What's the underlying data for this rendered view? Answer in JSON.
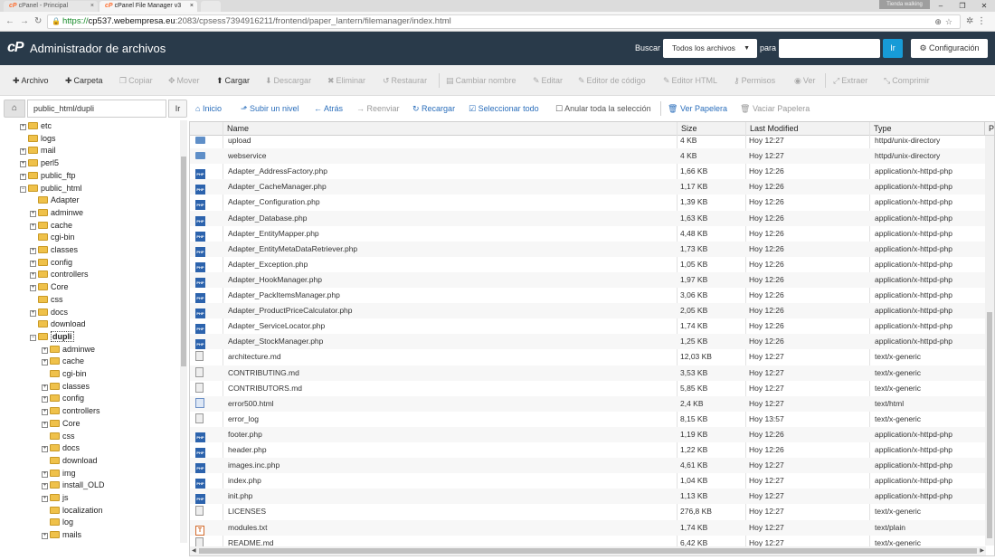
{
  "browser": {
    "tabs": [
      {
        "label": "cPanel - Principal"
      },
      {
        "label": "cPanel File Manager v3"
      }
    ],
    "profile": "Tienda walking",
    "url": {
      "scheme": "https://",
      "host": "cp537.webempresa.eu",
      "path": ":2083/cpsess7394916211/frontend/paper_lantern/filemanager/index.html"
    }
  },
  "header": {
    "logo": "cP",
    "title": "Administrador de archivos",
    "search_label": "Buscar",
    "search_scope": "Todos los archivos",
    "para_label": "para",
    "go_label": "Ir",
    "config_label": "Configuración"
  },
  "toolbar": {
    "archivo": "Archivo",
    "carpeta": "Carpeta",
    "copiar": "Copiar",
    "mover": "Mover",
    "cargar": "Cargar",
    "descargar": "Descargar",
    "eliminar": "Eliminar",
    "restaurar": "Restaurar",
    "cambiar_nombre": "Cambiar nombre",
    "editar": "Editar",
    "editor_codigo": "Editor de código",
    "editor_html": "Editor HTML",
    "permisos": "Permisos",
    "ver": "Ver",
    "extraer": "Extraer",
    "comprimir": "Comprimir"
  },
  "pathbar": {
    "value": "public_html/dupli",
    "go_label": "Ir"
  },
  "actions": {
    "inicio": "Inicio",
    "subir": "Subir un nivel",
    "atras": "Atrás",
    "reenviar": "Reenviar",
    "recargar": "Recargar",
    "seleccionar_todo": "Seleccionar todo",
    "anular": "Anular toda la selección",
    "ver_papelera": "Ver Papelera",
    "vaciar_papelera": "Vaciar Papelera"
  },
  "tree": [
    {
      "label": "etc",
      "level": 0,
      "expandable": true
    },
    {
      "label": "logs",
      "level": 0,
      "expandable": false
    },
    {
      "label": "mail",
      "level": 0,
      "expandable": true
    },
    {
      "label": "perl5",
      "level": 0,
      "expandable": true
    },
    {
      "label": "public_ftp",
      "level": 0,
      "expandable": true
    },
    {
      "label": "public_html",
      "level": 0,
      "expandable": true,
      "open": true
    },
    {
      "label": "Adapter",
      "level": 1,
      "expandable": false
    },
    {
      "label": "adminwe",
      "level": 1,
      "expandable": true
    },
    {
      "label": "cache",
      "level": 1,
      "expandable": true
    },
    {
      "label": "cgi-bin",
      "level": 1,
      "expandable": false
    },
    {
      "label": "classes",
      "level": 1,
      "expandable": true
    },
    {
      "label": "config",
      "level": 1,
      "expandable": true
    },
    {
      "label": "controllers",
      "level": 1,
      "expandable": true
    },
    {
      "label": "Core",
      "level": 1,
      "expandable": true
    },
    {
      "label": "css",
      "level": 1,
      "expandable": false
    },
    {
      "label": "docs",
      "level": 1,
      "expandable": true
    },
    {
      "label": "download",
      "level": 1,
      "expandable": false
    },
    {
      "label": "dupli",
      "level": 1,
      "expandable": true,
      "open": true,
      "selected": true
    },
    {
      "label": "adminwe",
      "level": 2,
      "expandable": true
    },
    {
      "label": "cache",
      "level": 2,
      "expandable": true
    },
    {
      "label": "cgi-bin",
      "level": 2,
      "expandable": false
    },
    {
      "label": "classes",
      "level": 2,
      "expandable": true
    },
    {
      "label": "config",
      "level": 2,
      "expandable": true
    },
    {
      "label": "controllers",
      "level": 2,
      "expandable": true
    },
    {
      "label": "Core",
      "level": 2,
      "expandable": true
    },
    {
      "label": "css",
      "level": 2,
      "expandable": false
    },
    {
      "label": "docs",
      "level": 2,
      "expandable": true
    },
    {
      "label": "download",
      "level": 2,
      "expandable": false
    },
    {
      "label": "img",
      "level": 2,
      "expandable": true
    },
    {
      "label": "install_OLD",
      "level": 2,
      "expandable": true
    },
    {
      "label": "js",
      "level": 2,
      "expandable": true
    },
    {
      "label": "localization",
      "level": 2,
      "expandable": false
    },
    {
      "label": "log",
      "level": 2,
      "expandable": false
    },
    {
      "label": "mails",
      "level": 2,
      "expandable": true
    }
  ],
  "table": {
    "headers": {
      "name": "Name",
      "size": "Size",
      "modified": "Last Modified",
      "type": "Type",
      "extra": "P"
    },
    "rows": [
      {
        "icon": "folder",
        "name": "upload",
        "size": "4 KB",
        "modified": "Hoy 12:27",
        "type": "httpd/unix-directory"
      },
      {
        "icon": "folder",
        "name": "webservice",
        "size": "4 KB",
        "modified": "Hoy 12:27",
        "type": "httpd/unix-directory"
      },
      {
        "icon": "php",
        "name": "Adapter_AddressFactory.php",
        "size": "1,66 KB",
        "modified": "Hoy 12:26",
        "type": "application/x-httpd-php"
      },
      {
        "icon": "php",
        "name": "Adapter_CacheManager.php",
        "size": "1,17 KB",
        "modified": "Hoy 12:26",
        "type": "application/x-httpd-php"
      },
      {
        "icon": "php",
        "name": "Adapter_Configuration.php",
        "size": "1,39 KB",
        "modified": "Hoy 12:26",
        "type": "application/x-httpd-php"
      },
      {
        "icon": "php",
        "name": "Adapter_Database.php",
        "size": "1,63 KB",
        "modified": "Hoy 12:26",
        "type": "application/x-httpd-php"
      },
      {
        "icon": "php",
        "name": "Adapter_EntityMapper.php",
        "size": "4,48 KB",
        "modified": "Hoy 12:26",
        "type": "application/x-httpd-php"
      },
      {
        "icon": "php",
        "name": "Adapter_EntityMetaDataRetriever.php",
        "size": "1,73 KB",
        "modified": "Hoy 12:26",
        "type": "application/x-httpd-php"
      },
      {
        "icon": "php",
        "name": "Adapter_Exception.php",
        "size": "1,05 KB",
        "modified": "Hoy 12:26",
        "type": "application/x-httpd-php"
      },
      {
        "icon": "php",
        "name": "Adapter_HookManager.php",
        "size": "1,97 KB",
        "modified": "Hoy 12:26",
        "type": "application/x-httpd-php"
      },
      {
        "icon": "php",
        "name": "Adapter_PackItemsManager.php",
        "size": "3,06 KB",
        "modified": "Hoy 12:26",
        "type": "application/x-httpd-php"
      },
      {
        "icon": "php",
        "name": "Adapter_ProductPriceCalculator.php",
        "size": "2,05 KB",
        "modified": "Hoy 12:26",
        "type": "application/x-httpd-php"
      },
      {
        "icon": "php",
        "name": "Adapter_ServiceLocator.php",
        "size": "1,74 KB",
        "modified": "Hoy 12:26",
        "type": "application/x-httpd-php"
      },
      {
        "icon": "php",
        "name": "Adapter_StockManager.php",
        "size": "1,25 KB",
        "modified": "Hoy 12:26",
        "type": "application/x-httpd-php"
      },
      {
        "icon": "generic",
        "name": "architecture.md",
        "size": "12,03 KB",
        "modified": "Hoy 12:27",
        "type": "text/x-generic"
      },
      {
        "icon": "generic",
        "name": "CONTRIBUTING.md",
        "size": "3,53 KB",
        "modified": "Hoy 12:27",
        "type": "text/x-generic"
      },
      {
        "icon": "generic",
        "name": "CONTRIBUTORS.md",
        "size": "5,85 KB",
        "modified": "Hoy 12:27",
        "type": "text/x-generic"
      },
      {
        "icon": "html",
        "name": "error500.html",
        "size": "2,4 KB",
        "modified": "Hoy 12:27",
        "type": "text/html"
      },
      {
        "icon": "generic",
        "name": "error_log",
        "size": "8,15 KB",
        "modified": "Hoy 13:57",
        "type": "text/x-generic"
      },
      {
        "icon": "php",
        "name": "footer.php",
        "size": "1,19 KB",
        "modified": "Hoy 12:26",
        "type": "application/x-httpd-php"
      },
      {
        "icon": "php",
        "name": "header.php",
        "size": "1,22 KB",
        "modified": "Hoy 12:26",
        "type": "application/x-httpd-php"
      },
      {
        "icon": "php",
        "name": "images.inc.php",
        "size": "4,61 KB",
        "modified": "Hoy 12:27",
        "type": "application/x-httpd-php"
      },
      {
        "icon": "php",
        "name": "index.php",
        "size": "1,04 KB",
        "modified": "Hoy 12:27",
        "type": "application/x-httpd-php"
      },
      {
        "icon": "php",
        "name": "init.php",
        "size": "1,13 KB",
        "modified": "Hoy 12:27",
        "type": "application/x-httpd-php"
      },
      {
        "icon": "generic",
        "name": "LICENSES",
        "size": "276,8 KB",
        "modified": "Hoy 12:27",
        "type": "text/x-generic"
      },
      {
        "icon": "text",
        "name": "modules.txt",
        "size": "1,74 KB",
        "modified": "Hoy 12:27",
        "type": "text/plain"
      },
      {
        "icon": "generic",
        "name": "README.md",
        "size": "6,42 KB",
        "modified": "Hoy 12:27",
        "type": "text/x-generic"
      }
    ]
  },
  "colors": {
    "header_bg": "#293a4a",
    "accent_blue": "#179bd7",
    "link_blue": "#2a6ebb",
    "folder_yellow": "#efc14a"
  }
}
